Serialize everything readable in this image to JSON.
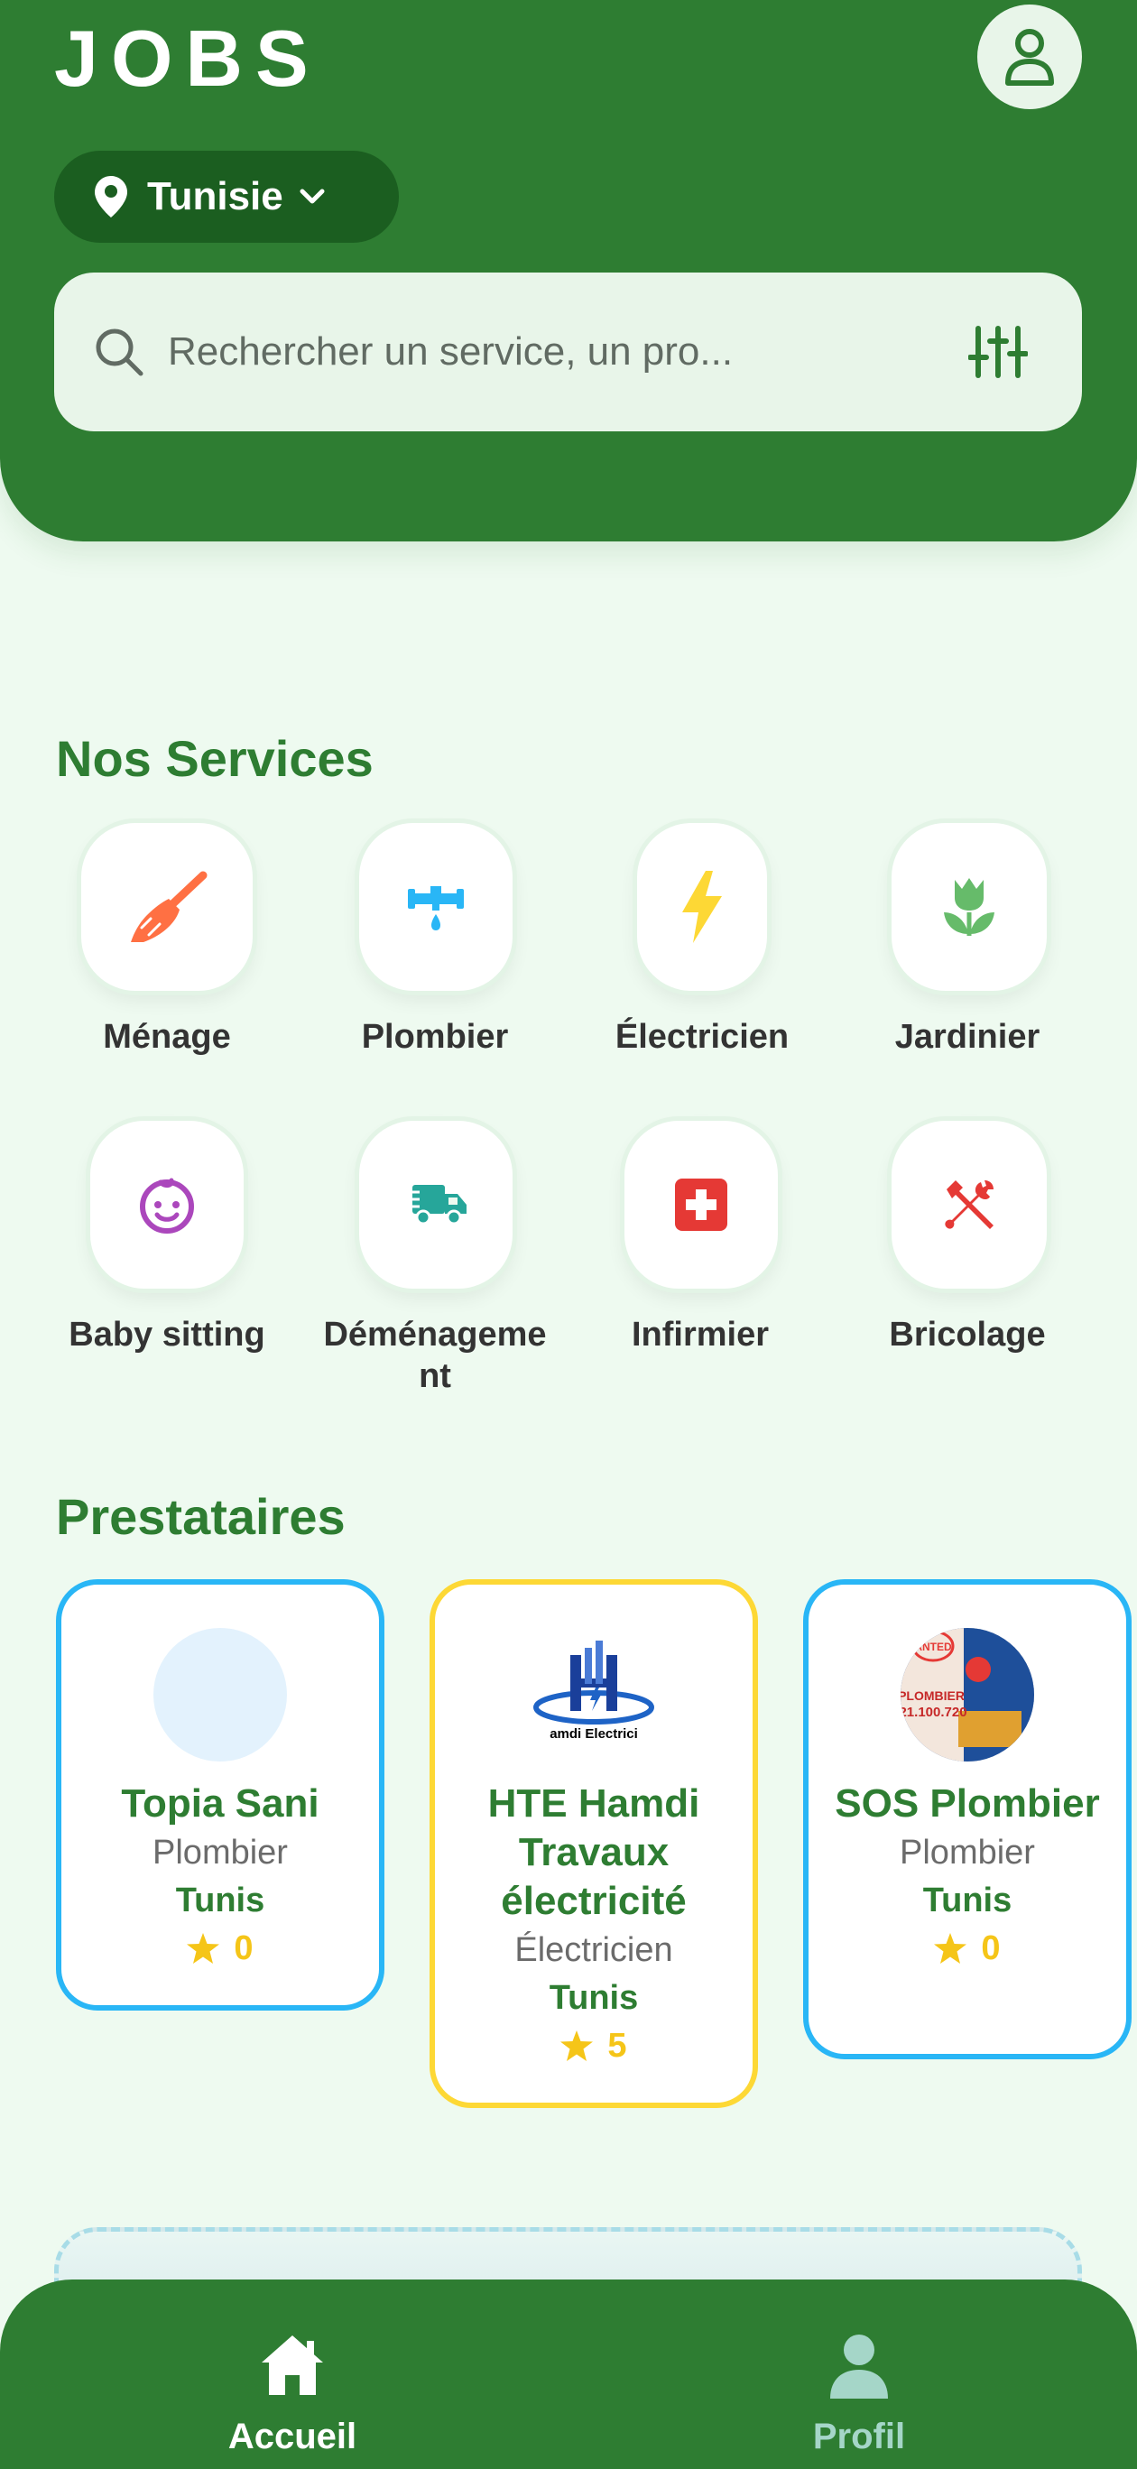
{
  "header": {
    "app_title": "JOBS",
    "location": "Tunisie",
    "search_placeholder": "Rechercher un service, un pro..."
  },
  "services": {
    "title": "Nos Services",
    "items": [
      {
        "label": "Ménage",
        "icon": "broom-icon",
        "color": "#ff7043"
      },
      {
        "label": "Plombier",
        "icon": "faucet-icon",
        "color": "#29b6f6"
      },
      {
        "label": "Électricien",
        "icon": "lightning-icon",
        "color": "#fdd835"
      },
      {
        "label": "Jardinier",
        "icon": "tulip-icon",
        "color": "#66bb6a"
      },
      {
        "label": "Baby sitting",
        "icon": "baby-face-icon",
        "color": "#ab47bc"
      },
      {
        "label": "Déménageme\nnt",
        "icon": "truck-icon",
        "color": "#26a69a"
      },
      {
        "label": "Infirmier",
        "icon": "medical-cross-icon",
        "color": "#e53935"
      },
      {
        "label": "Bricolage",
        "icon": "tools-icon",
        "color": "#e53935"
      }
    ]
  },
  "providers": {
    "title": "Prestataires",
    "items": [
      {
        "name": "Topia Sani",
        "job": "Plombier",
        "city": "Tunis",
        "rating": "0",
        "border": "#29b6f6"
      },
      {
        "name": "HTE Hamdi Travaux électricité",
        "job": "Électricien",
        "city": "Tunis",
        "rating": "5",
        "border": "#fdd835",
        "logo_text": "amdi Electrici"
      },
      {
        "name": "SOS Plombier",
        "job": "Plombier",
        "city": "Tunis",
        "rating": "0",
        "border": "#29b6f6",
        "photo_text_1": "PLOMBIER",
        "photo_text_2": "21.100.720",
        "photo_stamp": "ANTED"
      }
    ]
  },
  "nav": {
    "home": "Accueil",
    "profile": "Profil"
  },
  "colors": {
    "primary": "#2e7d32",
    "background": "#eefaf0",
    "rating": "#f5c518"
  }
}
